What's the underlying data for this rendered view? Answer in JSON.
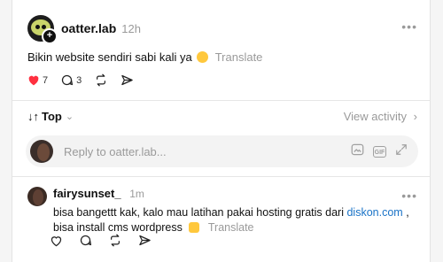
{
  "post": {
    "username": "oatter.lab",
    "time": "12h",
    "text": "Bikin website sendiri sabi kali ya",
    "translate": "Translate",
    "likes": "7",
    "comments": "3"
  },
  "sort": {
    "label": "Top",
    "view_activity": "View activity"
  },
  "reply": {
    "placeholder": "Reply to oatter.lab..."
  },
  "comment": {
    "username": "fairysunset_",
    "time": "1m",
    "text_before_link": "bisa bangettt kak, kalo mau latihan pakai hosting gratis dari",
    "link": "diskon.com",
    "text_after_link": ", bisa install cms wordpress",
    "translate": "Translate"
  },
  "colors": {
    "like_red": "#ff3040",
    "link_blue": "#1a73c7",
    "muted": "#9a9a9a"
  }
}
